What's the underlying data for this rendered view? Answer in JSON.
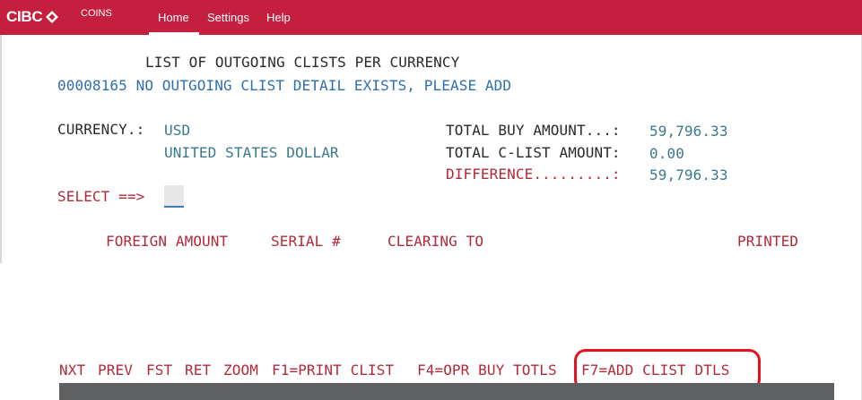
{
  "header": {
    "logo_text": "CIBC",
    "app_name": "COINS",
    "nav": [
      "Home",
      "Settings",
      "Help"
    ],
    "brand_color": "#c41f3e"
  },
  "screen": {
    "title": "LIST OF OUTGOING CLISTS PER CURRENCY",
    "message": "00008165 NO OUTGOING CLIST DETAIL EXISTS, PLEASE ADD",
    "currency_label": "CURRENCY.:",
    "currency_code": "USD",
    "currency_name": "UNITED STATES DOLLAR",
    "total_buy_label": "TOTAL BUY AMOUNT...:",
    "total_buy_value": "59,796.33",
    "total_clist_label": "TOTAL C-LIST AMOUNT:",
    "total_clist_value": "0.00",
    "difference_label": "DIFFERENCE.........:",
    "difference_value": "59,796.33",
    "select_label": "SELECT ==>",
    "select_value": ""
  },
  "columns": [
    "FOREIGN AMOUNT",
    "SERIAL #",
    "CLEARING TO",
    "PRINTED"
  ],
  "function_keys": [
    "NXT",
    "PREV",
    "FST",
    "RET",
    "ZOOM",
    "F1=PRINT CLIST",
    "F4=OPR BUY TOTLS",
    "F7=ADD CLIST DTLS"
  ],
  "colors": {
    "text_black": "#2a2a2a",
    "text_blue": "#2f6fb0",
    "text_teal": "#3a7a8c",
    "text_red": "#b22a3a",
    "highlight": "#e8101c"
  }
}
